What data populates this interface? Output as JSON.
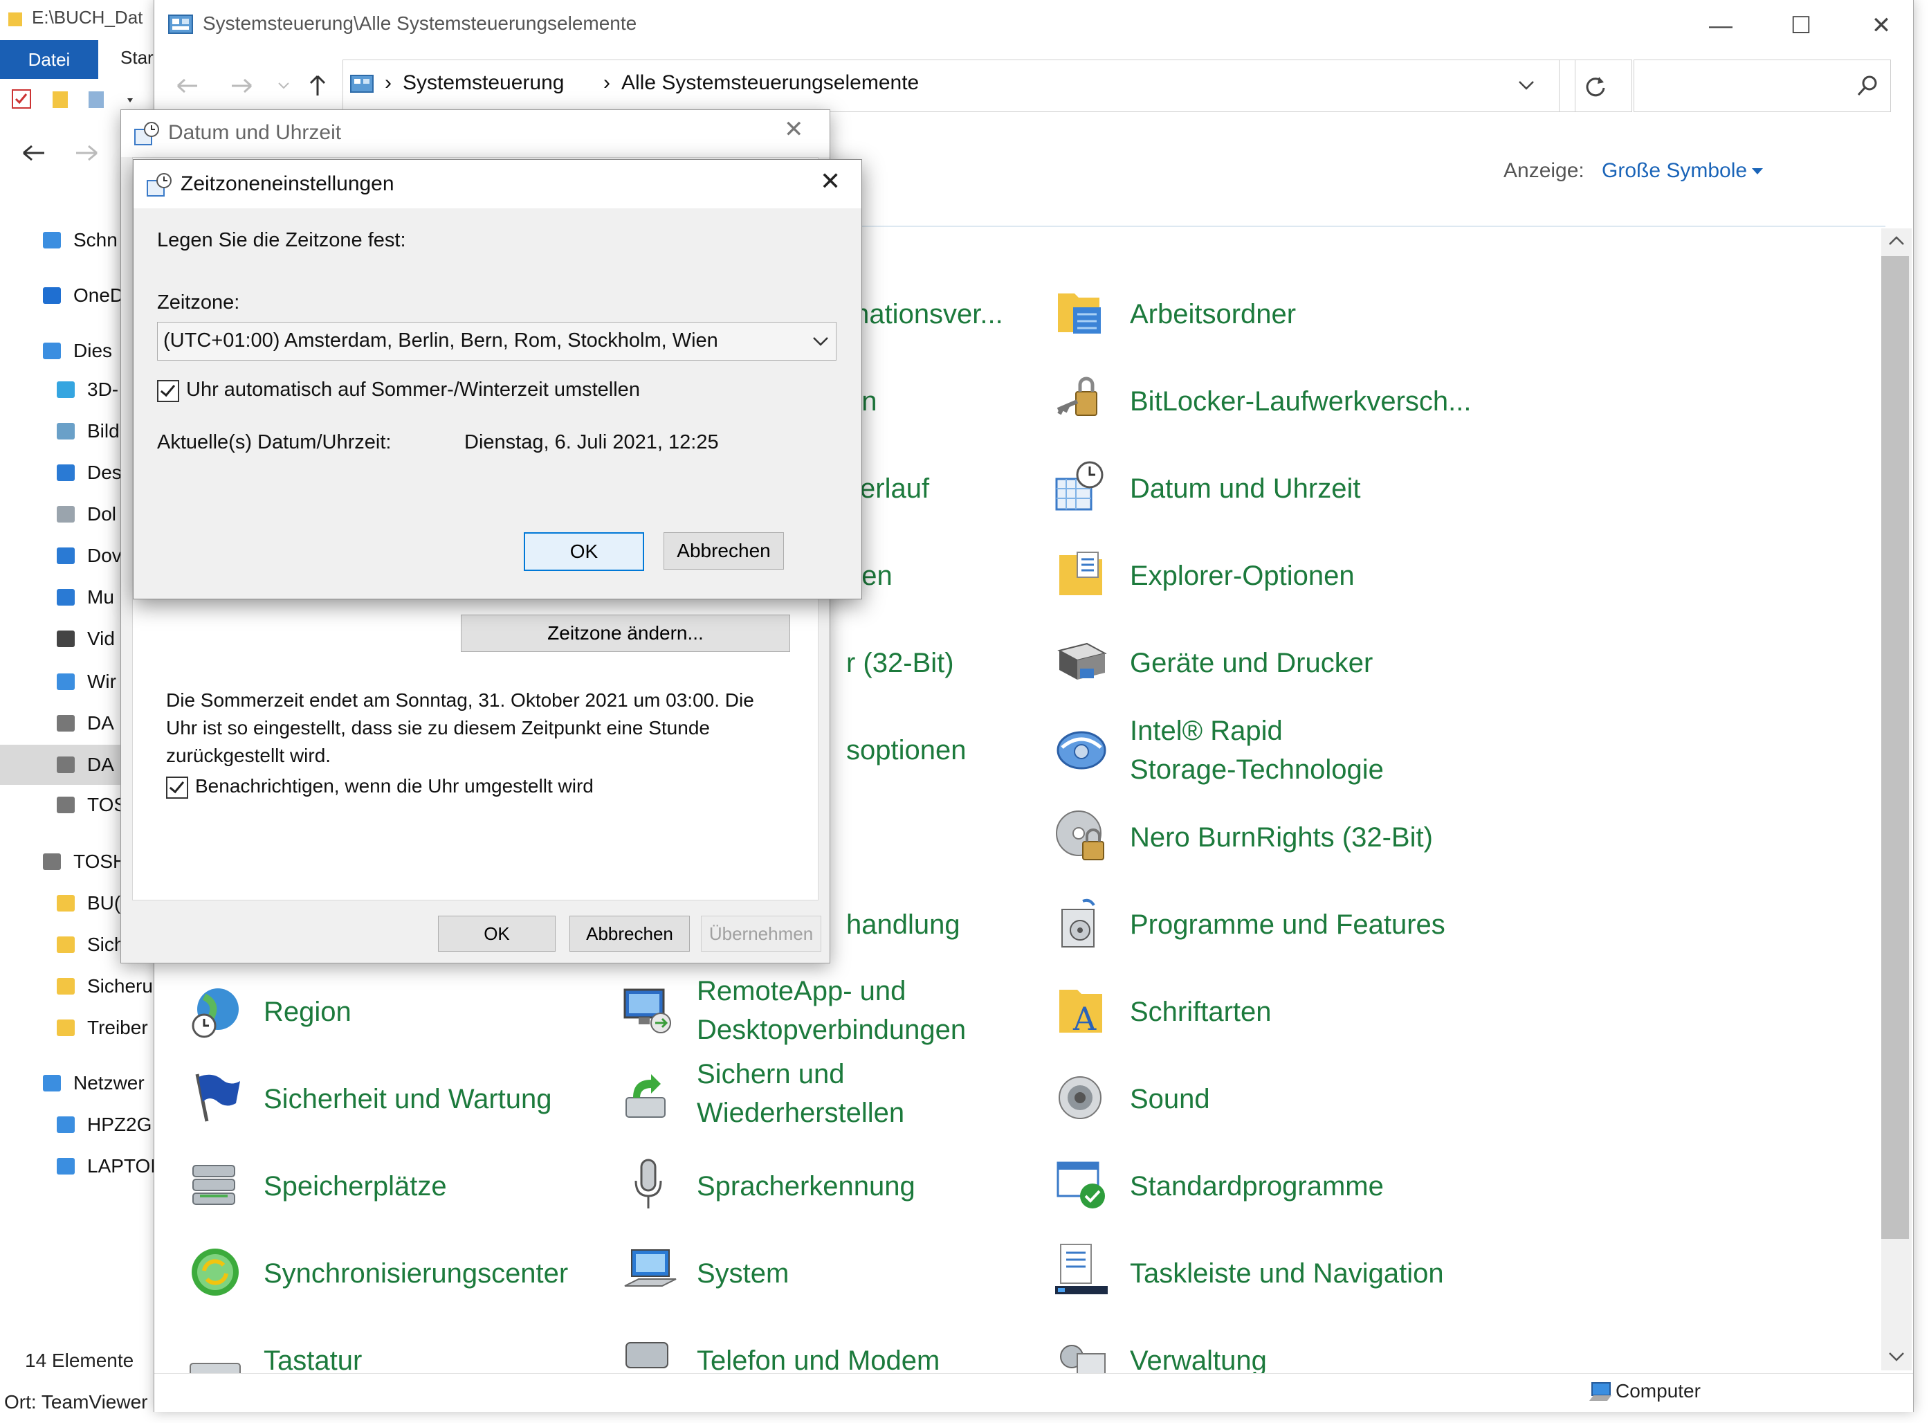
{
  "background_window": {
    "title": "E:\\BUCH_Dat",
    "ribbon_tabs": [
      "Datei",
      "Star"
    ],
    "nav_items": [
      {
        "label": "Schn",
        "icon": "star-icon"
      },
      {
        "label": "OneD",
        "icon": "cloud-icon"
      },
      {
        "label": "Dies",
        "icon": "computer-icon"
      },
      {
        "label": "3D-",
        "icon": "cube-icon"
      },
      {
        "label": "Bild",
        "icon": "pictures-icon"
      },
      {
        "label": "Des",
        "icon": "desktop-icon"
      },
      {
        "label": "Dol",
        "icon": "document-icon"
      },
      {
        "label": "Dov",
        "icon": "download-icon"
      },
      {
        "label": "Mu",
        "icon": "music-icon"
      },
      {
        "label": "Vid",
        "icon": "video-icon"
      },
      {
        "label": "Wir",
        "icon": "windows-drive-icon"
      },
      {
        "label": "DA",
        "icon": "drive-icon"
      },
      {
        "label": "DA",
        "icon": "drive-icon"
      },
      {
        "label": "TOS",
        "icon": "drive-icon"
      },
      {
        "label": "TOSH",
        "icon": "drive-icon"
      },
      {
        "label": "BU(",
        "icon": "folder-icon"
      },
      {
        "label": "Sich",
        "icon": "folder-icon"
      },
      {
        "label": "Sicheru",
        "icon": "folder-icon"
      },
      {
        "label": "Treiber",
        "icon": "folder-icon"
      },
      {
        "label": "Netzwer",
        "icon": "network-icon"
      },
      {
        "label": "HPZ2G",
        "icon": "pc-icon"
      },
      {
        "label": "LAPTOI",
        "icon": "pc-icon"
      }
    ],
    "item_count": "14 Elemente",
    "location": "Ort: TeamViewer"
  },
  "control_panel": {
    "title": "Systemsteuerung\\Alle Systemsteuerungselemente",
    "breadcrumb": [
      "Systemsteuerung",
      "Alle Systemsteuerungselemente"
    ],
    "view_label": "Anzeige:",
    "view_value": "Große Symbole",
    "items_col1": [
      {
        "label": "Region",
        "icon": "globe-clock-icon"
      },
      {
        "label": "Sicherheit und Wartung",
        "icon": "flag-icon"
      },
      {
        "label": "Speicherplätze",
        "icon": "storage-stack-icon"
      },
      {
        "label": "Synchronisierungscenter",
        "icon": "sync-icon"
      },
      {
        "label": "Tastatur",
        "icon": "keyboard-icon"
      }
    ],
    "items_col2_partial": [
      {
        "label": "mationsver..."
      },
      {
        "label": "en"
      },
      {
        "label": "verlauf"
      },
      {
        "label": "nen"
      },
      {
        "label": "r (32-Bit)"
      },
      {
        "label": "soptionen"
      },
      {
        "label": "handlung"
      }
    ],
    "items_col2": [
      {
        "label": "RemoteApp- und",
        "label2": "Desktopverbindungen",
        "icon": "remote-desktop-icon"
      },
      {
        "label": "Sichern und",
        "label2": "Wiederherstellen",
        "icon": "backup-icon"
      },
      {
        "label": "Spracherkennung",
        "icon": "microphone-icon"
      },
      {
        "label": "System",
        "icon": "system-monitor-icon"
      },
      {
        "label": "Telefon und Modem",
        "icon": "phone-icon"
      }
    ],
    "items_col3": [
      {
        "label": "Arbeitsordner",
        "icon": "work-folders-icon"
      },
      {
        "label": "BitLocker-Laufwerkversch...",
        "icon": "bitlocker-key-icon"
      },
      {
        "label": "Datum und Uhrzeit",
        "icon": "calendar-clock-icon"
      },
      {
        "label": "Explorer-Optionen",
        "icon": "folder-options-icon"
      },
      {
        "label": "Geräte und Drucker",
        "icon": "printer-icon"
      },
      {
        "label": "Intel® Rapid",
        "label2": "Storage-Technologie",
        "icon": "intel-rapid-icon"
      },
      {
        "label": "Nero BurnRights (32-Bit)",
        "icon": "disc-lock-icon"
      },
      {
        "label": "Programme und Features",
        "icon": "programs-icon"
      },
      {
        "label": "Schriftarten",
        "icon": "fonts-icon"
      },
      {
        "label": "Sound",
        "icon": "speaker-icon"
      },
      {
        "label": "Standardprogramme",
        "icon": "default-programs-icon"
      },
      {
        "label": "Taskleiste und Navigation",
        "icon": "taskbar-icon"
      },
      {
        "label": "Verwaltung",
        "icon": "admin-tools-icon"
      }
    ],
    "status_computer": "Computer"
  },
  "datum_dialog": {
    "title": "Datum und Uhrzeit",
    "change_zone_button": "Zeitzone ändern...",
    "dst_line1": "Die Sommerzeit endet am Sonntag, 31. Oktober 2021 um 03:00. Die",
    "dst_line2": "Uhr ist so eingestellt, dass sie zu diesem Zeitpunkt eine Stunde",
    "dst_line3": "zurückgestellt wird.",
    "notify_label": "Benachrichtigen, wenn die Uhr umgestellt wird",
    "ok": "OK",
    "cancel": "Abbrechen",
    "apply": "Übernehmen"
  },
  "zone_dialog": {
    "title": "Zeitzoneneinstellungen",
    "instruction": "Legen Sie die Zeitzone fest:",
    "zone_label": "Zeitzone:",
    "zone_value": "(UTC+01:00) Amsterdam, Berlin, Bern, Rom, Stockholm, Wien",
    "auto_dst_label": "Uhr automatisch auf Sommer-/Winterzeit umstellen",
    "current_label": "Aktuelle(s) Datum/Uhrzeit:",
    "current_value": "Dienstag, 6. Juli 2021, 12:25",
    "ok": "OK",
    "cancel": "Abbrechen"
  }
}
